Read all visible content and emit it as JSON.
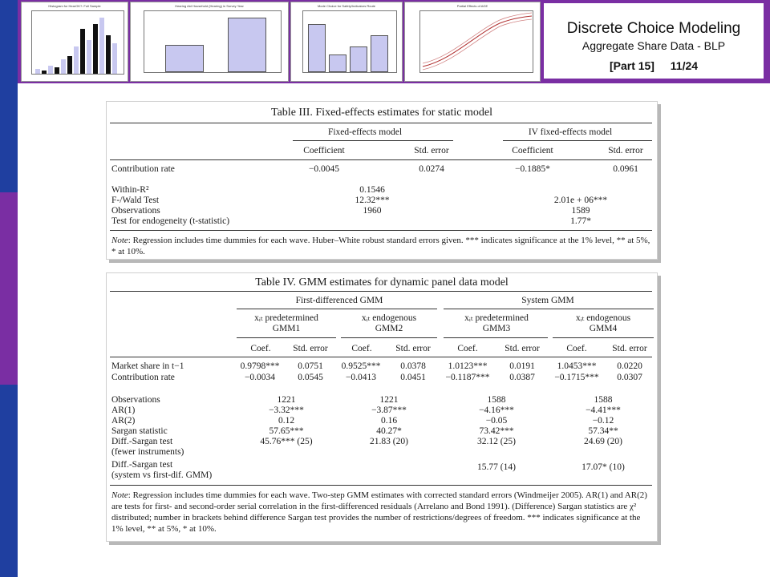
{
  "header": {
    "title": "Discrete Choice Modeling",
    "subtitle": "Aggregate Share Data - BLP",
    "part": "[Part 15]",
    "page": "11/24",
    "thumbnails": [
      {
        "title": "Histogram for HearOK?: Full Sample"
      },
      {
        "title": "Hearing Aid Household (Hearing) in Survey Year"
      },
      {
        "title": "Mode Choice for Safety/Indicators Route"
      },
      {
        "title": "Partial Effects of AGE"
      }
    ]
  },
  "table3": {
    "title": "Table III.  Fixed-effects estimates for static model",
    "group1": "Fixed-effects model",
    "group2": "IV fixed-effects model",
    "col_coef": "Coefficient",
    "col_se": "Std. error",
    "rows": [
      {
        "label": "Contribution rate",
        "v1": "−0.0045",
        "v2": "0.0274",
        "v3": "−0.1885*",
        "v4": "0.0961"
      }
    ],
    "stats": [
      {
        "label": "Within-R²",
        "fe": "0.1546",
        "iv": ""
      },
      {
        "label": "F-/Wald Test",
        "fe": "12.32***",
        "iv": "2.01e + 06***"
      },
      {
        "label": "Observations",
        "fe": "1960",
        "iv": "1589"
      },
      {
        "label": "Test for endogeneity (t-statistic)",
        "fe": "",
        "iv": "1.77*"
      }
    ],
    "note_lead": "Note",
    "note": ": Regression includes time dummies for each wave. Huber–White robust standard errors given. *** indicates significance at the 1% level, ** at 5%, * at 10%."
  },
  "table4": {
    "title": "Table IV.  GMM estimates for dynamic panel data model",
    "group1": "First-differenced GMM",
    "group2": "System GMM",
    "sub": [
      {
        "line1": "xᵢₜ predetermined",
        "line2": "GMM1"
      },
      {
        "line1": "xᵢₜ endogenous",
        "line2": "GMM2"
      },
      {
        "line1": "xᵢₜ predetermined",
        "line2": "GMM3"
      },
      {
        "line1": "xᵢₜ endogenous",
        "line2": "GMM4"
      }
    ],
    "col_coef": "Coef.",
    "col_se": "Std. error",
    "rows": [
      {
        "label": "Market share in t−1",
        "v": [
          "0.9798***",
          "0.0751",
          "0.9525***",
          "0.0378",
          "1.0123***",
          "0.0191",
          "1.0453***",
          "0.0220"
        ]
      },
      {
        "label": "Contribution rate",
        "v": [
          "−0.0034",
          "0.0545",
          "−0.0413",
          "0.0451",
          "−0.1187***",
          "0.0387",
          "−0.1715***",
          "0.0307"
        ]
      }
    ],
    "stats": [
      {
        "label": "Observations",
        "v": [
          "1221",
          "1221",
          "1588",
          "1588"
        ]
      },
      {
        "label": "AR(1)",
        "v": [
          "−3.32***",
          "−3.87***",
          "−4.16***",
          "−4.41***"
        ]
      },
      {
        "label": "AR(2)",
        "v": [
          "0.12",
          "0.16",
          "−0.05",
          "−0.12"
        ]
      },
      {
        "label": "Sargan statistic",
        "v": [
          "57.65***",
          "40.27*",
          "73.42***",
          "57.34**"
        ]
      },
      {
        "label": "Diff.-Sargan test",
        "v": [
          "45.76*** (25)",
          "21.83 (20)",
          "32.12 (25)",
          "24.69 (20)"
        ]
      },
      {
        "label": "(fewer instruments)",
        "v": [
          "",
          "",
          "",
          ""
        ]
      },
      {
        "label": "Diff.-Sargan test",
        "v": [
          "",
          "",
          "15.77 (14)",
          "17.07* (10)"
        ]
      },
      {
        "label": "(system vs first-dif. GMM)",
        "v": [
          "",
          "",
          "",
          ""
        ]
      }
    ],
    "note_lead": "Note",
    "note": ": Regression includes time dummies for each wave. Two-step GMM estimates with corrected standard errors (Windmeijer 2005). AR(1) and AR(2) are tests for first- and second-order serial correlation in the first-differenced residuals (Arrelano and Bond 1991). (Difference) Sargan statistics are χ² distributed; number in brackets behind difference Sargan test provides the number of restrictions/degrees of freedom. *** indicates significance at the 1% level, ** at 5%, * at 10%."
  },
  "colors": {
    "leftbar": "#1f3fa0",
    "header": "#7a2ea3",
    "thumb_bar": "#c8c8f0"
  }
}
